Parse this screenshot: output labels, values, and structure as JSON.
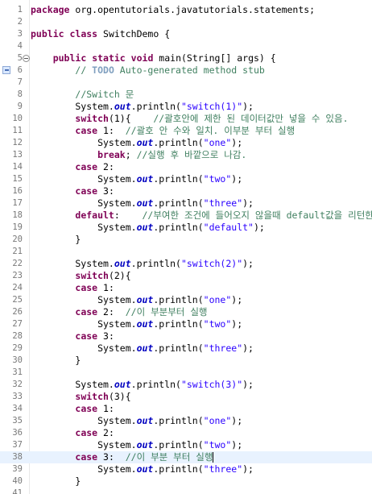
{
  "editor": {
    "language": "java",
    "current_line": 38,
    "lines": [
      {
        "n": "1",
        "segs": [
          [
            "kw",
            "package"
          ],
          [
            "t",
            " org.opentutorials.javatutorials.statements;"
          ]
        ]
      },
      {
        "n": "2",
        "segs": []
      },
      {
        "n": "3",
        "segs": [
          [
            "kw",
            "public"
          ],
          [
            "t",
            " "
          ],
          [
            "kw",
            "class"
          ],
          [
            "t",
            " SwitchDemo {"
          ]
        ]
      },
      {
        "n": "4",
        "segs": []
      },
      {
        "n": "5",
        "fold": true,
        "segs": [
          [
            "t",
            "    "
          ],
          [
            "kw",
            "public"
          ],
          [
            "t",
            " "
          ],
          [
            "kw",
            "static"
          ],
          [
            "t",
            " "
          ],
          [
            "kw",
            "void"
          ],
          [
            "t",
            " main(String[] args) {"
          ]
        ]
      },
      {
        "n": "6",
        "task": true,
        "segs": [
          [
            "t",
            "        "
          ],
          [
            "cm",
            "// "
          ],
          [
            "todo",
            "TODO"
          ],
          [
            "cm",
            " Auto-generated method stub"
          ]
        ]
      },
      {
        "n": "7",
        "segs": []
      },
      {
        "n": "8",
        "segs": [
          [
            "t",
            "        "
          ],
          [
            "cm",
            "//Switch 문"
          ]
        ]
      },
      {
        "n": "9",
        "segs": [
          [
            "t",
            "        System."
          ],
          [
            "fld",
            "out"
          ],
          [
            "t",
            ".println("
          ],
          [
            "str",
            "\"switch(1)\""
          ],
          [
            "t",
            ");"
          ]
        ]
      },
      {
        "n": "10",
        "segs": [
          [
            "t",
            "        "
          ],
          [
            "kw",
            "switch"
          ],
          [
            "t",
            "(1){    "
          ],
          [
            "cm",
            "//괄호안에 제한 된 데이터값만 넣을 수 있음."
          ]
        ]
      },
      {
        "n": "11",
        "segs": [
          [
            "t",
            "        "
          ],
          [
            "kw",
            "case"
          ],
          [
            "t",
            " 1:  "
          ],
          [
            "cm",
            "//괄호 안 수와 일치. 이부분 부터 실행"
          ]
        ]
      },
      {
        "n": "12",
        "segs": [
          [
            "t",
            "            System."
          ],
          [
            "fld",
            "out"
          ],
          [
            "t",
            ".println("
          ],
          [
            "str",
            "\"one\""
          ],
          [
            "t",
            ");"
          ]
        ]
      },
      {
        "n": "13",
        "segs": [
          [
            "t",
            "            "
          ],
          [
            "kw",
            "break"
          ],
          [
            "t",
            "; "
          ],
          [
            "cm",
            "//실행 후 바깥으로 나감."
          ]
        ]
      },
      {
        "n": "14",
        "segs": [
          [
            "t",
            "        "
          ],
          [
            "kw",
            "case"
          ],
          [
            "t",
            " 2:"
          ]
        ]
      },
      {
        "n": "15",
        "segs": [
          [
            "t",
            "            System."
          ],
          [
            "fld",
            "out"
          ],
          [
            "t",
            ".println("
          ],
          [
            "str",
            "\"two\""
          ],
          [
            "t",
            ");"
          ]
        ]
      },
      {
        "n": "16",
        "segs": [
          [
            "t",
            "        "
          ],
          [
            "kw",
            "case"
          ],
          [
            "t",
            " 3:"
          ]
        ]
      },
      {
        "n": "17",
        "segs": [
          [
            "t",
            "            System."
          ],
          [
            "fld",
            "out"
          ],
          [
            "t",
            ".println("
          ],
          [
            "str",
            "\"three\""
          ],
          [
            "t",
            ");"
          ]
        ]
      },
      {
        "n": "18",
        "segs": [
          [
            "t",
            "        "
          ],
          [
            "kw",
            "default"
          ],
          [
            "t",
            ":    "
          ],
          [
            "cm",
            "//부여한 조건에 들어오지 않을때 default값을 리턴한다."
          ]
        ]
      },
      {
        "n": "19",
        "segs": [
          [
            "t",
            "            System."
          ],
          [
            "fld",
            "out"
          ],
          [
            "t",
            ".println("
          ],
          [
            "str",
            "\"default\""
          ],
          [
            "t",
            ");"
          ]
        ]
      },
      {
        "n": "20",
        "segs": [
          [
            "t",
            "        }"
          ]
        ]
      },
      {
        "n": "21",
        "segs": []
      },
      {
        "n": "22",
        "segs": [
          [
            "t",
            "        System."
          ],
          [
            "fld",
            "out"
          ],
          [
            "t",
            ".println("
          ],
          [
            "str",
            "\"switch(2)\""
          ],
          [
            "t",
            ");"
          ]
        ]
      },
      {
        "n": "23",
        "segs": [
          [
            "t",
            "        "
          ],
          [
            "kw",
            "switch"
          ],
          [
            "t",
            "(2){"
          ]
        ]
      },
      {
        "n": "24",
        "segs": [
          [
            "t",
            "        "
          ],
          [
            "kw",
            "case"
          ],
          [
            "t",
            " 1:"
          ]
        ]
      },
      {
        "n": "25",
        "segs": [
          [
            "t",
            "            System."
          ],
          [
            "fld",
            "out"
          ],
          [
            "t",
            ".println("
          ],
          [
            "str",
            "\"one\""
          ],
          [
            "t",
            ");"
          ]
        ]
      },
      {
        "n": "26",
        "segs": [
          [
            "t",
            "        "
          ],
          [
            "kw",
            "case"
          ],
          [
            "t",
            " 2:  "
          ],
          [
            "cm",
            "//이 부분부터 실행"
          ]
        ]
      },
      {
        "n": "27",
        "segs": [
          [
            "t",
            "            System."
          ],
          [
            "fld",
            "out"
          ],
          [
            "t",
            ".println("
          ],
          [
            "str",
            "\"two\""
          ],
          [
            "t",
            ");"
          ]
        ]
      },
      {
        "n": "28",
        "segs": [
          [
            "t",
            "        "
          ],
          [
            "kw",
            "case"
          ],
          [
            "t",
            " 3:"
          ]
        ]
      },
      {
        "n": "29",
        "segs": [
          [
            "t",
            "            System."
          ],
          [
            "fld",
            "out"
          ],
          [
            "t",
            ".println("
          ],
          [
            "str",
            "\"three\""
          ],
          [
            "t",
            ");"
          ]
        ]
      },
      {
        "n": "30",
        "segs": [
          [
            "t",
            "        }"
          ]
        ]
      },
      {
        "n": "31",
        "segs": []
      },
      {
        "n": "32",
        "segs": [
          [
            "t",
            "        System."
          ],
          [
            "fld",
            "out"
          ],
          [
            "t",
            ".println("
          ],
          [
            "str",
            "\"switch(3)\""
          ],
          [
            "t",
            ");"
          ]
        ]
      },
      {
        "n": "33",
        "segs": [
          [
            "t",
            "        "
          ],
          [
            "kw",
            "switch"
          ],
          [
            "t",
            "(3){"
          ]
        ]
      },
      {
        "n": "34",
        "segs": [
          [
            "t",
            "        "
          ],
          [
            "kw",
            "case"
          ],
          [
            "t",
            " 1:"
          ]
        ]
      },
      {
        "n": "35",
        "segs": [
          [
            "t",
            "            System."
          ],
          [
            "fld",
            "out"
          ],
          [
            "t",
            ".println("
          ],
          [
            "str",
            "\"one\""
          ],
          [
            "t",
            ");"
          ]
        ]
      },
      {
        "n": "36",
        "segs": [
          [
            "t",
            "        "
          ],
          [
            "kw",
            "case"
          ],
          [
            "t",
            " 2:"
          ]
        ]
      },
      {
        "n": "37",
        "segs": [
          [
            "t",
            "            System."
          ],
          [
            "fld",
            "out"
          ],
          [
            "t",
            ".println("
          ],
          [
            "str",
            "\"two\""
          ],
          [
            "t",
            ");"
          ]
        ]
      },
      {
        "n": "38",
        "caret": true,
        "segs": [
          [
            "t",
            "        "
          ],
          [
            "kw",
            "case"
          ],
          [
            "t",
            " 3:  "
          ],
          [
            "cm",
            "//이 부분 부터 실행"
          ]
        ]
      },
      {
        "n": "39",
        "segs": [
          [
            "t",
            "            System."
          ],
          [
            "fld",
            "out"
          ],
          [
            "t",
            ".println("
          ],
          [
            "str",
            "\"three\""
          ],
          [
            "t",
            ");"
          ]
        ]
      },
      {
        "n": "40",
        "segs": [
          [
            "t",
            "        }"
          ]
        ]
      },
      {
        "n": "41",
        "segs": []
      }
    ]
  },
  "colors": {
    "keyword": "#7f0055",
    "string": "#2a00ff",
    "comment": "#3f7f5f",
    "todo": "#7f9fbf",
    "field": "#0000c0",
    "line_number": "#787878",
    "current_line_bg": "#e8f2fe"
  },
  "icons": {
    "fold": "collapse-fold-icon",
    "task": "task-marker-icon"
  }
}
